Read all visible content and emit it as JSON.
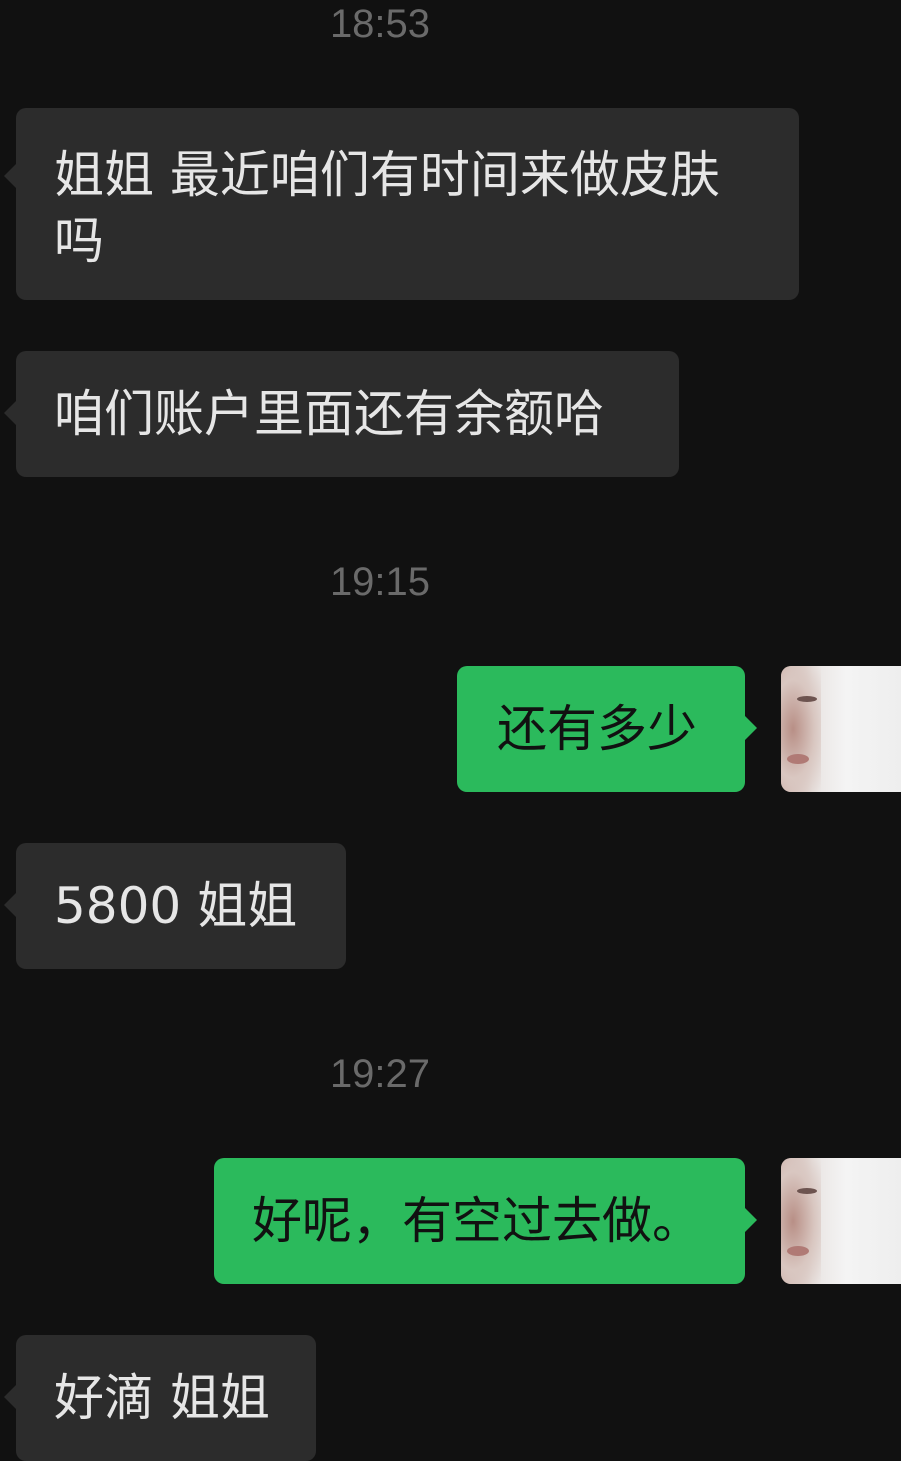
{
  "chat": {
    "timestamps": [
      "18:53",
      "19:15",
      "19:27"
    ],
    "messages": [
      {
        "direction": "incoming",
        "text": "姐姐 最近咱们有时间来做皮肤吗"
      },
      {
        "direction": "incoming",
        "text": "咱们账户里面还有余额哈"
      },
      {
        "direction": "outgoing",
        "text": "还有多少"
      },
      {
        "direction": "incoming",
        "text": "5800 姐姐"
      },
      {
        "direction": "outgoing",
        "text": "好呢，有空过去做。"
      },
      {
        "direction": "incoming",
        "text": "好滴 姐姐"
      }
    ],
    "colors": {
      "background": "#111111",
      "incoming_bubble": "#2c2c2c",
      "outgoing_bubble": "#2bba5c",
      "timestamp_text": "#6a6a6a"
    }
  }
}
